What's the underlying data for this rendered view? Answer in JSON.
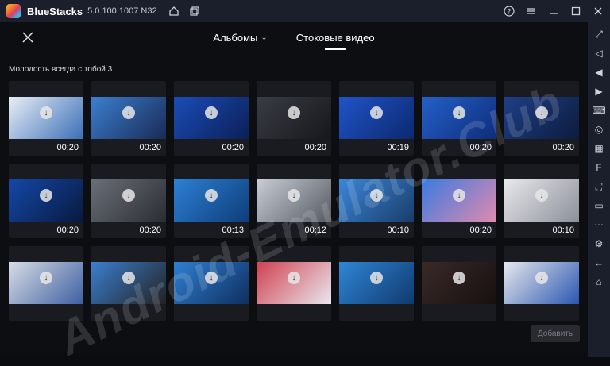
{
  "titlebar": {
    "app_name": "BlueStacks",
    "version": "5.0.100.1007 N32",
    "icons": [
      "home-icon",
      "multi-instance-icon",
      "help-icon",
      "menu-icon",
      "minimize-icon",
      "maximize-icon",
      "close-icon"
    ]
  },
  "header": {
    "tabs": [
      {
        "label": "Альбомы",
        "has_dropdown": true,
        "active": false
      },
      {
        "label": "Стоковые видео",
        "has_dropdown": false,
        "active": true
      }
    ]
  },
  "section": {
    "title": "Молодость всегда с тобой 3"
  },
  "videos": [
    {
      "duration": "00:20",
      "colors": [
        "#e9eef5",
        "#3a6fb8"
      ]
    },
    {
      "duration": "00:20",
      "colors": [
        "#3b7fd0",
        "#1a2a55"
      ]
    },
    {
      "duration": "00:20",
      "colors": [
        "#1a4db8",
        "#0c1f57"
      ]
    },
    {
      "duration": "00:20",
      "colors": [
        "#3a3d44",
        "#15171c"
      ]
    },
    {
      "duration": "00:19",
      "colors": [
        "#1f55c8",
        "#0c2870"
      ]
    },
    {
      "duration": "00:20",
      "colors": [
        "#2460c9",
        "#0e2d7a"
      ]
    },
    {
      "duration": "00:20",
      "colors": [
        "#1e3f86",
        "#0d1c3e"
      ]
    },
    {
      "duration": "00:20",
      "colors": [
        "#1448a8",
        "#08193e"
      ]
    },
    {
      "duration": "00:20",
      "colors": [
        "#6a6f77",
        "#2a2d33"
      ]
    },
    {
      "duration": "00:13",
      "colors": [
        "#2d7fd4",
        "#0e3e7a"
      ]
    },
    {
      "duration": "00:12",
      "colors": [
        "#c8cdd6",
        "#555a63"
      ]
    },
    {
      "duration": "00:10",
      "colors": [
        "#3b86d8",
        "#1a3d6a"
      ]
    },
    {
      "duration": "00:20",
      "colors": [
        "#3a7be0",
        "#e08ab0"
      ]
    },
    {
      "duration": "00:10",
      "colors": [
        "#e6e8ec",
        "#8c9099"
      ]
    },
    {
      "duration": "",
      "colors": [
        "#d8dde5",
        "#3d5fa0"
      ]
    },
    {
      "duration": "",
      "colors": [
        "#3b7fd0",
        "#222"
      ]
    },
    {
      "duration": "",
      "colors": [
        "#2f7fd0",
        "#0f2f60"
      ]
    },
    {
      "duration": "",
      "colors": [
        "#d04050",
        "#e8e8ee"
      ]
    },
    {
      "duration": "",
      "colors": [
        "#2f86d6",
        "#103a70"
      ]
    },
    {
      "duration": "",
      "colors": [
        "#3a2a28",
        "#15100f"
      ]
    },
    {
      "duration": "",
      "colors": [
        "#e6e8ec",
        "#2a56b0"
      ]
    }
  ],
  "add_button": {
    "label": "Добавить"
  },
  "sidebar_icons": [
    "expand-icon",
    "volume-down-icon",
    "volume-up-icon",
    "screen-record-icon",
    "keyboard-icon",
    "play-icon",
    "macro-icon",
    "fps-icon",
    "screenshot-icon",
    "folder-icon",
    "more-icon",
    "settings-icon",
    "back-icon",
    "home-icon"
  ],
  "watermark": {
    "text": "Android-Emulator.Club"
  }
}
